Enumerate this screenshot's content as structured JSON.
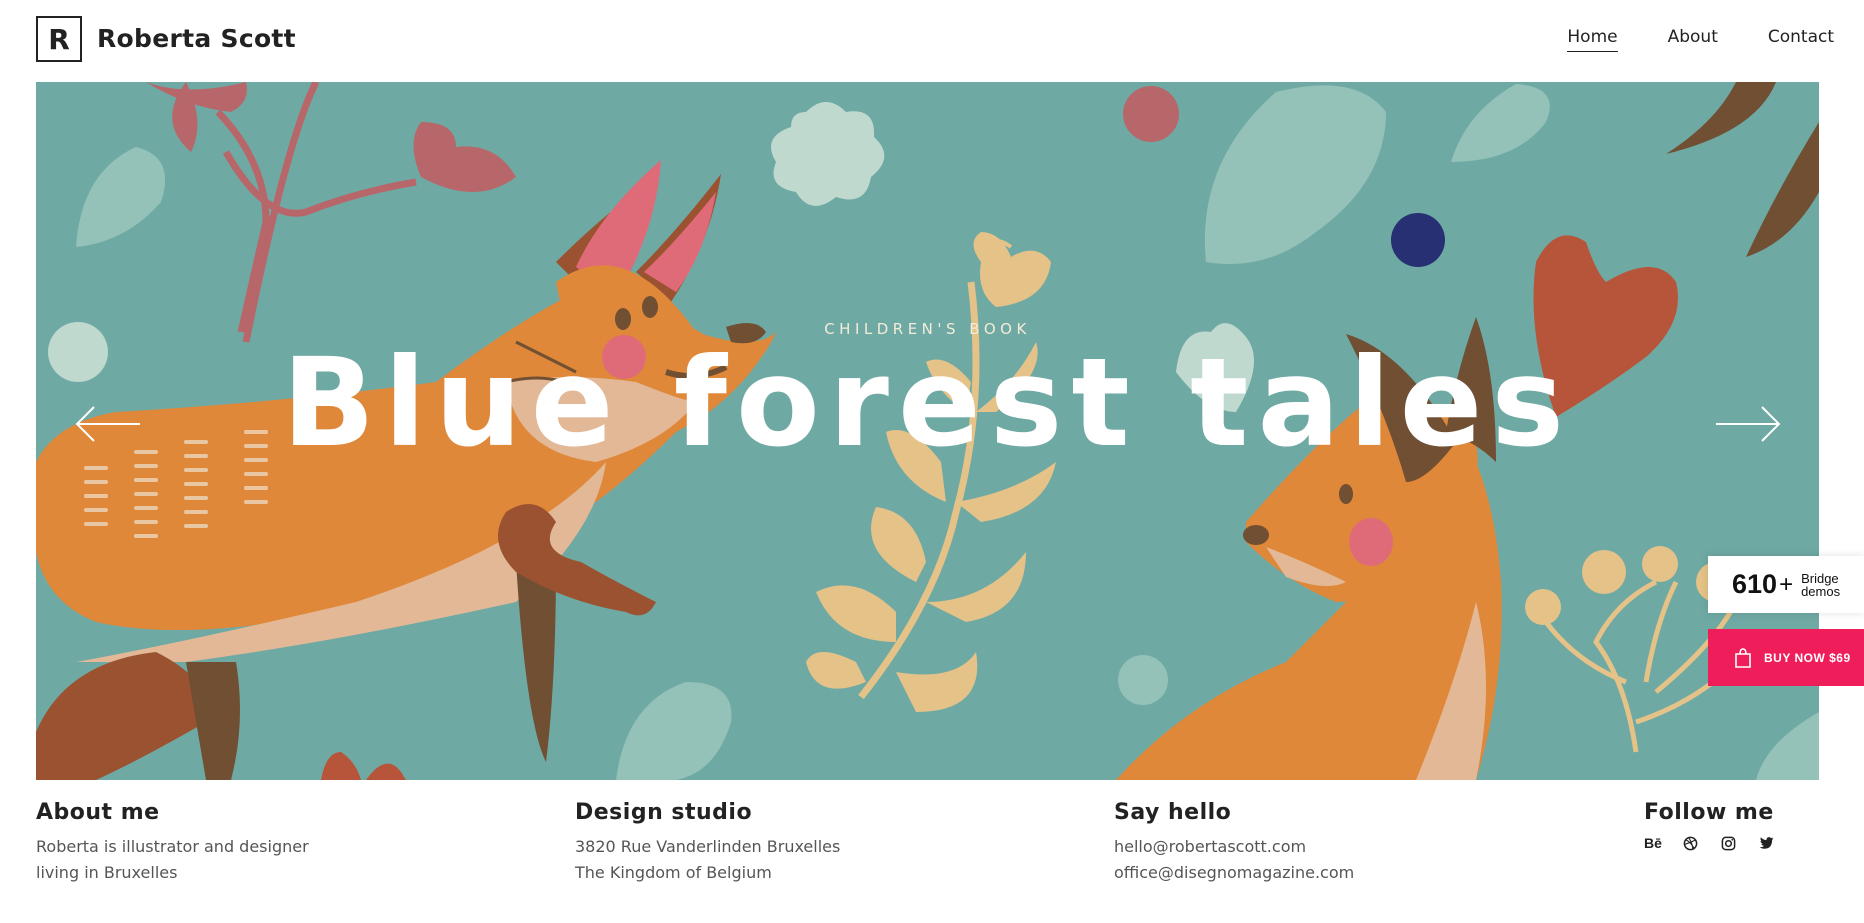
{
  "brand": {
    "logo_letter": "R",
    "name": "Roberta Scott"
  },
  "nav": [
    {
      "label": "Home",
      "active": true
    },
    {
      "label": "About",
      "active": false
    },
    {
      "label": "Contact",
      "active": false
    }
  ],
  "hero": {
    "eyebrow": "CHILDREN'S BOOK",
    "title": "Blue forest tales",
    "background_color": "#6fa9a4"
  },
  "demos_widget": {
    "count": "610",
    "plus": "+",
    "line1": "Bridge",
    "line2": "demos"
  },
  "buy_button": {
    "label": "BUY NOW $69",
    "color": "#ef1e5a",
    "icon": "shopping-bag-icon"
  },
  "footer": {
    "about": {
      "heading": "About me",
      "lines": [
        "Roberta is illustrator and designer",
        "living in Bruxelles"
      ]
    },
    "studio": {
      "heading": "Design studio",
      "lines": [
        "3820 Rue Vanderlinden Bruxelles",
        "The Kingdom of Belgium"
      ]
    },
    "hello": {
      "heading": "Say hello",
      "lines": [
        "hello@robertascott.com",
        "office@disegnomagazine.com"
      ]
    },
    "follow": {
      "heading": "Follow me",
      "icons": [
        "behance-icon",
        "dribbble-icon",
        "instagram-icon",
        "twitter-icon"
      ],
      "behance_label": "Bē"
    }
  }
}
